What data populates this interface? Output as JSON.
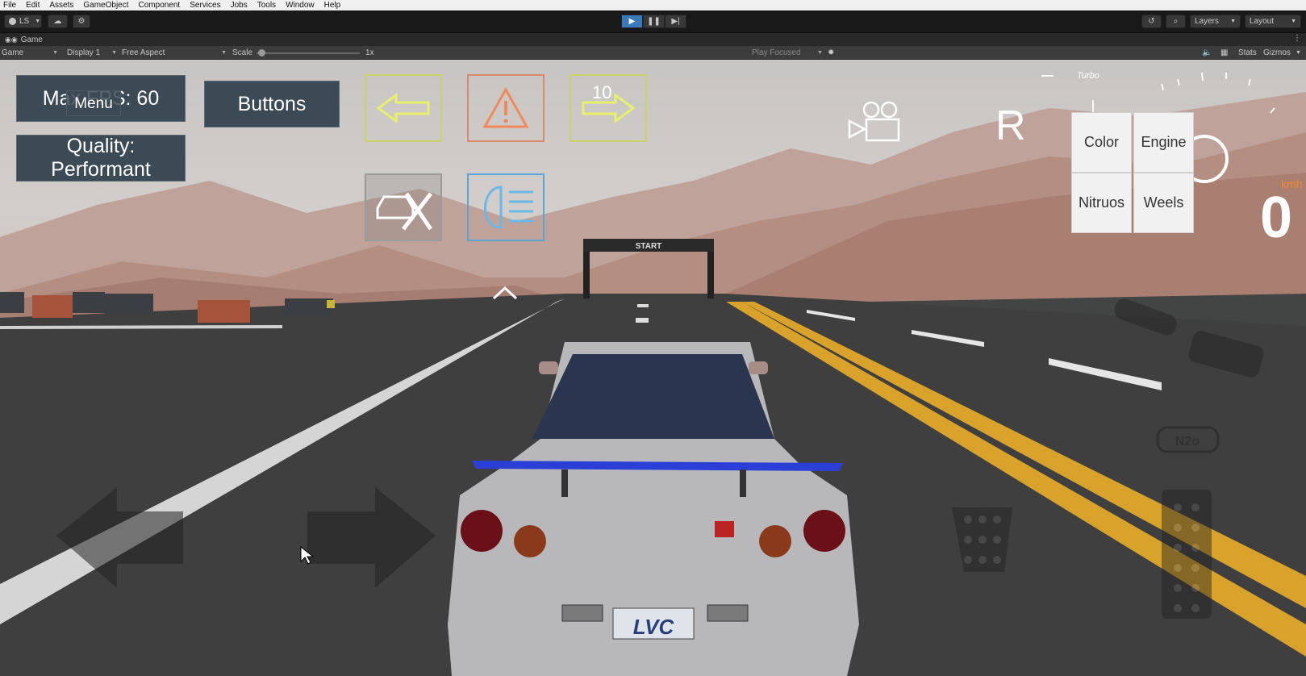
{
  "menu": [
    "File",
    "Edit",
    "Assets",
    "GameObject",
    "Component",
    "Services",
    "Jobs",
    "Tools",
    "Window",
    "Help"
  ],
  "toolbar": {
    "account_label": "LS",
    "layers_label": "Layers",
    "layout_label": "Layout"
  },
  "tab": {
    "label": "Game"
  },
  "options": {
    "view_select": "Game",
    "display_select": "Display 1",
    "aspect_select": "Free Aspect",
    "scale_label": "Scale",
    "scale_value": "1x",
    "play_focused": "Play Focused",
    "stats": "Stats",
    "gizmos": "Gizmos"
  },
  "game_ui": {
    "fps_text": "Max FPS: 60",
    "menu_text": "Menu",
    "quality_text": "Quality: Performant",
    "buttons_text": "Buttons",
    "countdown_text": "10",
    "gear_text": "R",
    "turbo_label": "Turbo",
    "speed_unit": "kmh",
    "speed_value": "0",
    "nitro_label": "N2o",
    "start_banner": "START",
    "plate_text": "LVC",
    "panel": {
      "color": "Color",
      "engine": "Engine",
      "nitro": "Nitruos",
      "wheels": "Weels"
    }
  },
  "colors": {
    "arrow_button_border": "#c9d36a",
    "hazard_border": "#d98a6a",
    "light_button_border": "#5aa7d6",
    "active_play": "#3a79bb",
    "spoiler": "#2b3fd6"
  }
}
